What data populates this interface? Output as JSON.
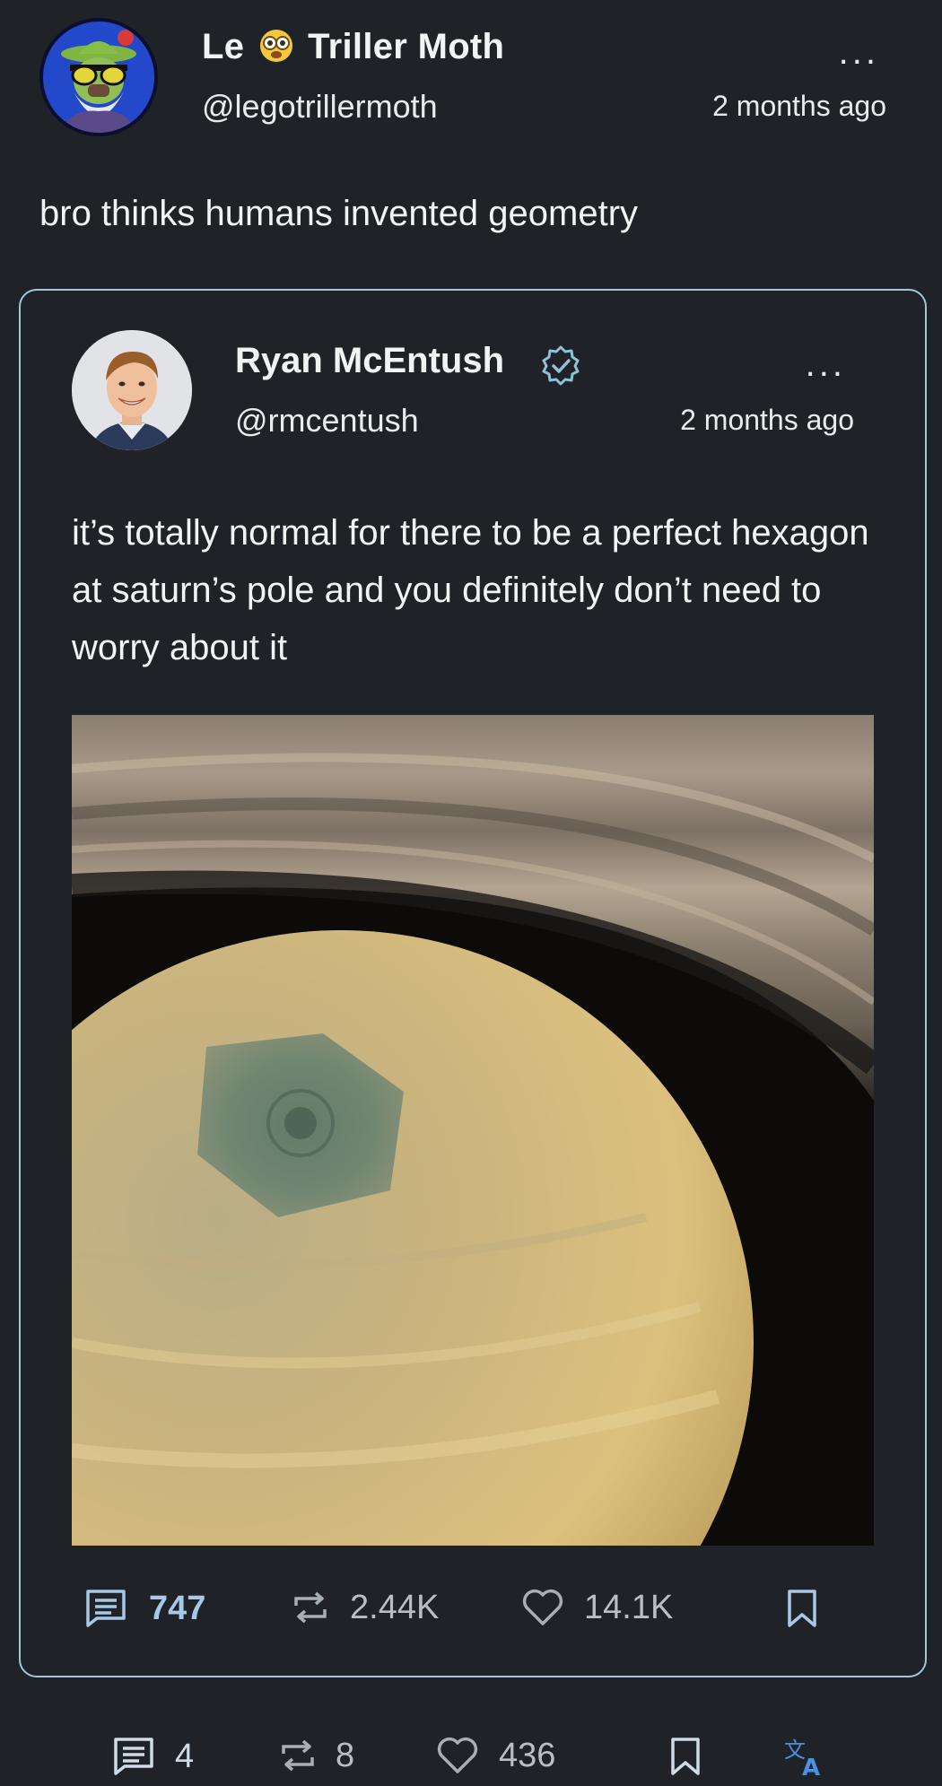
{
  "post": {
    "author_name_prefix": "Le",
    "author_name_suffix": "Triller Moth",
    "handle": "@legotrillermoth",
    "time": "2 months ago",
    "more": "...",
    "text": "bro thinks humans invented geometry"
  },
  "quoted_post": {
    "author_name": "Ryan McEntush",
    "handle": "@rmcentush",
    "time": "2 months ago",
    "more": "...",
    "text": "it’s totally normal for there to be a perfect hexagon at saturn’s pole and you definitely don’t need to worry about it",
    "stats": {
      "replies": "747",
      "reposts": "2.44K",
      "likes": "14.1K"
    }
  },
  "post_stats": {
    "replies": "4",
    "reposts": "8",
    "likes": "436"
  },
  "icons": {
    "reply": "reply-icon",
    "repost": "repost-icon",
    "like": "heart-icon",
    "bookmark": "bookmark-icon",
    "translate": "translate-icon",
    "verified": "verified-badge-icon"
  },
  "colors": {
    "background": "#1f2226",
    "quote_border": "#9fc7d8",
    "translate_icon": "#4a90e2"
  }
}
